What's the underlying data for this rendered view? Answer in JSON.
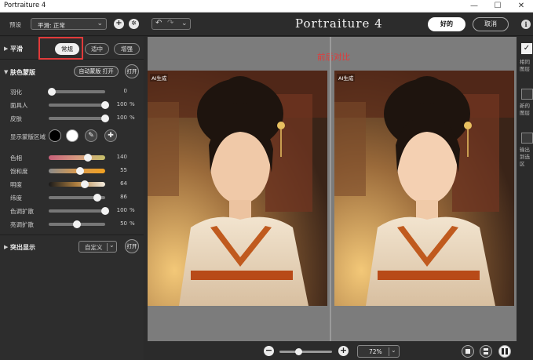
{
  "window": {
    "title": "Portraiture 4",
    "minimize": "—",
    "maximize": "☐",
    "close": "✕"
  },
  "toolbar": {
    "preset_label": "预设",
    "preset_value": "平滑: 正常",
    "preset_chevron": "⌄",
    "add": "+",
    "settings": "✲",
    "undo": "↶",
    "redo": "↷",
    "history_chevron": "⌄",
    "brand": "Portraiture 4",
    "ok": "好的",
    "cancel": "取消",
    "info": "i"
  },
  "smoothing": {
    "title": "平滑",
    "options": [
      "常规",
      "适中",
      "增强"
    ],
    "selected": "常规"
  },
  "skin_mask": {
    "title": "肤色蒙版",
    "auto_mask": "自动蒙版 打开",
    "open": "打开",
    "sliders": [
      {
        "label": "羽化",
        "value": "0",
        "unit": "",
        "level": 0.05
      },
      {
        "label": "面具人",
        "value": "100",
        "unit": "%",
        "level": 1.0
      },
      {
        "label": "皮肤",
        "value": "100",
        "unit": "%",
        "level": 1.0
      }
    ],
    "show_mask_label": "显示蒙版区域",
    "color_sliders": [
      {
        "label": "色相",
        "value": "140",
        "unit": "",
        "level": 0.7
      },
      {
        "label": "饱和度",
        "value": "55",
        "unit": "",
        "level": 0.55
      },
      {
        "label": "明度",
        "value": "64",
        "unit": "",
        "level": 0.64
      },
      {
        "label": "纬度",
        "value": "86",
        "unit": "",
        "level": 0.86
      },
      {
        "label": "色调扩散",
        "value": "100",
        "unit": "%",
        "level": 1.0
      },
      {
        "label": "亮调扩散",
        "value": "50",
        "unit": "%",
        "level": 0.5
      }
    ]
  },
  "highlight": {
    "title": "突出显示",
    "preset": "自定义",
    "chevron": "⌄",
    "open": "打开"
  },
  "canvas": {
    "annotation": "前后对比",
    "watermark_left": "AI生成",
    "watermark_right": "AI生成"
  },
  "right_strip": {
    "check": "✓",
    "text1": "相同图层",
    "text2": "新的图层",
    "text3": "输出到选区"
  },
  "bottom": {
    "zoom_out": "−",
    "zoom_in": "+",
    "zoom_value": "72%",
    "zoom_chevron": "⌄",
    "zoom_level": 0.36
  },
  "colors": {
    "accent_red": "#e23a3a",
    "hue_gradient": "linear-gradient(90deg,#c8607a,#d79a80,#c6c06a)",
    "sat_gradient": "linear-gradient(90deg,#8a8a8a,#d89a50,#f0a020)",
    "light_gradient": "linear-gradient(90deg,#1a1a1a,#b08040,#f4ede0)"
  }
}
